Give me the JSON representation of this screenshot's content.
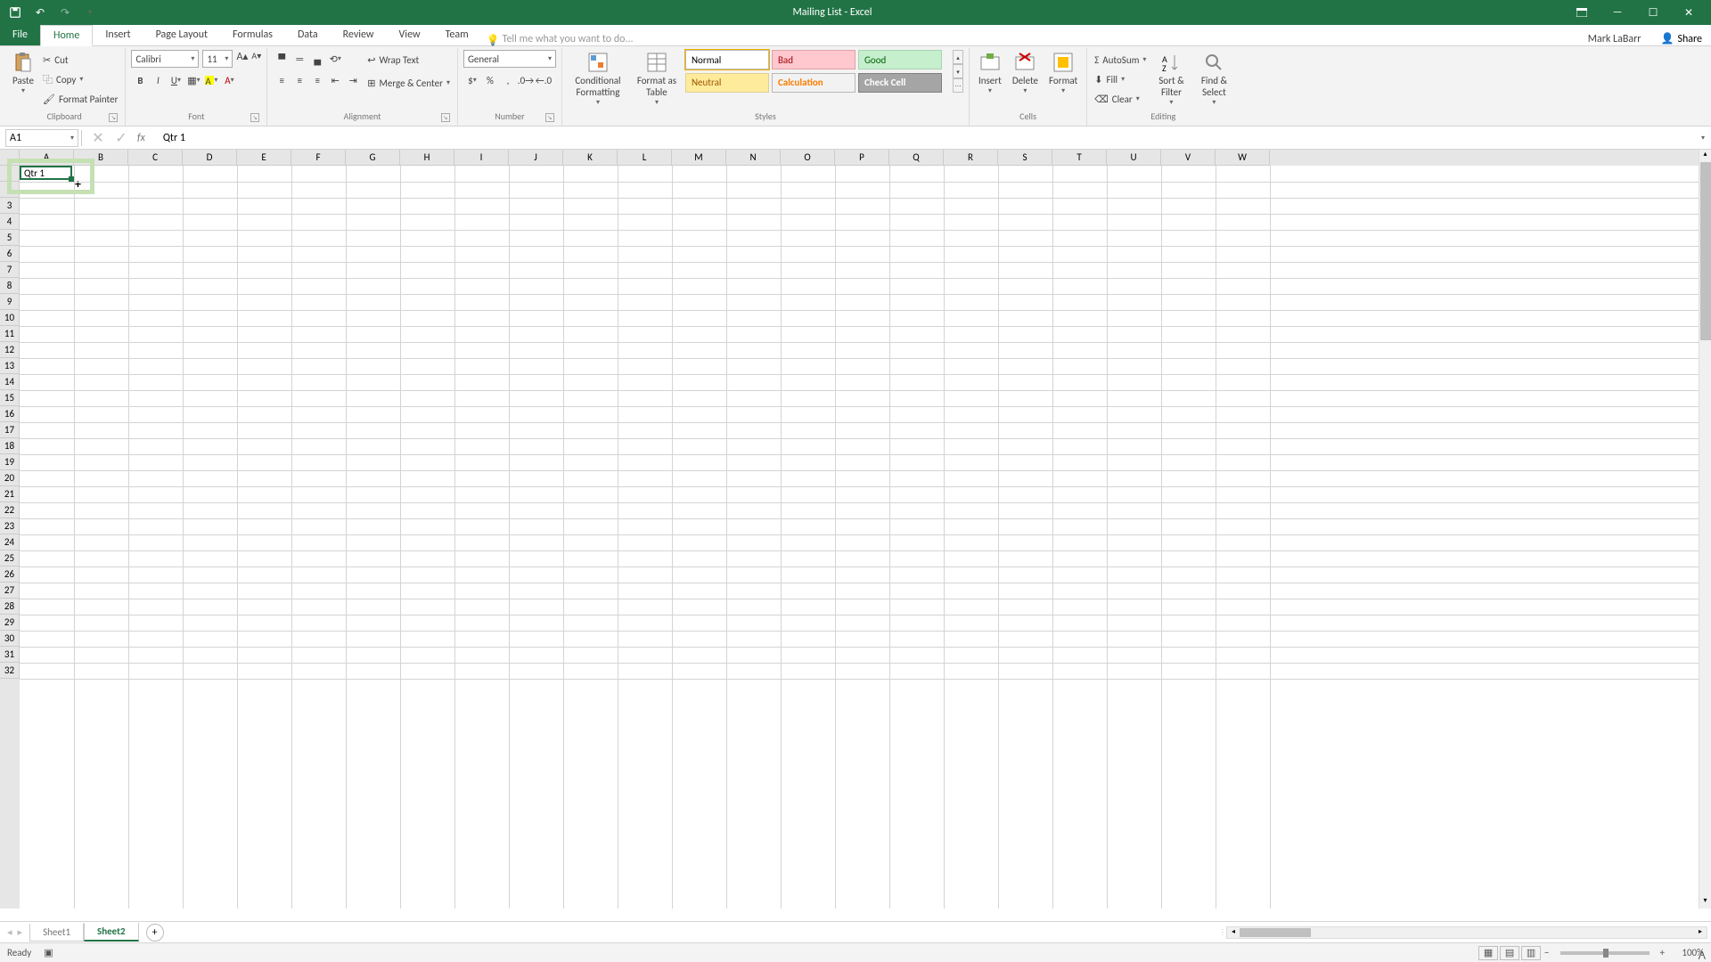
{
  "app_title": "Mailing List - Excel",
  "user_name": "Mark LaBarr",
  "share_label": "Share",
  "file_tab": "File",
  "ribbon_tabs": [
    "Home",
    "Insert",
    "Page Layout",
    "Formulas",
    "Data",
    "Review",
    "View",
    "Team"
  ],
  "active_ribbon_tab": "Home",
  "tellme_placeholder": "Tell me what you want to do...",
  "clipboard": {
    "paste": "Paste",
    "cut": "Cut",
    "copy": "Copy",
    "painter": "Format Painter",
    "label": "Clipboard"
  },
  "font": {
    "name": "Calibri",
    "size": "11",
    "label": "Font"
  },
  "alignment": {
    "wrap": "Wrap Text",
    "merge": "Merge & Center",
    "label": "Alignment"
  },
  "number": {
    "format": "General",
    "label": "Number"
  },
  "styles": {
    "cond": "Conditional Formatting",
    "table": "Format as Table",
    "cells_styles": [
      {
        "label": "Normal",
        "bg": "#ffffff",
        "fg": "#000000",
        "border": "#b8b8b8"
      },
      {
        "label": "Bad",
        "bg": "#ffc7ce",
        "fg": "#9c0006",
        "border": "#e0a0a8"
      },
      {
        "label": "Good",
        "bg": "#c6efce",
        "fg": "#006100",
        "border": "#a8d4b0"
      },
      {
        "label": "Neutral",
        "bg": "#ffeb9c",
        "fg": "#9c5700",
        "border": "#e0d090"
      },
      {
        "label": "Calculation",
        "bg": "#f2f2f2",
        "fg": "#fa7d00",
        "border": "#b8b8b8"
      },
      {
        "label": "Check Cell",
        "bg": "#a5a5a5",
        "fg": "#ffffff",
        "border": "#808080"
      }
    ],
    "label": "Styles"
  },
  "cells": {
    "insert": "Insert",
    "delete": "Delete",
    "format": "Format",
    "label": "Cells"
  },
  "editing": {
    "autosum": "AutoSum",
    "fill": "Fill",
    "clear": "Clear",
    "sort": "Sort & Filter",
    "find": "Find & Select",
    "label": "Editing"
  },
  "name_box": "A1",
  "formula_value": "Qtr 1",
  "columns": [
    "A",
    "B",
    "C",
    "D",
    "E",
    "F",
    "G",
    "H",
    "I",
    "J",
    "K",
    "L",
    "M",
    "N",
    "O",
    "P",
    "Q",
    "R",
    "S",
    "T",
    "U",
    "V",
    "W"
  ],
  "row_count": 32,
  "cell_A1": "Qtr 1",
  "sheets": [
    "Sheet1",
    "Sheet2"
  ],
  "active_sheet": "Sheet2",
  "status_ready": "Ready",
  "zoom": "100%"
}
